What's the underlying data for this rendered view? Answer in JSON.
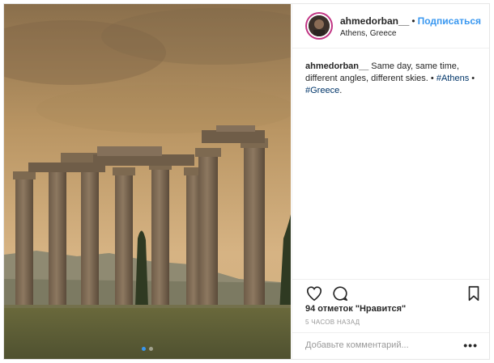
{
  "post": {
    "username": "ahmedorban__",
    "separator": "•",
    "follow_label": "Подписаться",
    "location": "Athens, Greece",
    "caption": {
      "username": "ahmedorban__",
      "text": " Same day, same time, different angles, different skies. • ",
      "tag1": "#Athens",
      "bullet": " • ",
      "tag2": "#Greece",
      "end": "."
    },
    "likes_text": "94 отметок \"Нравится\"",
    "time_text": "5 ЧАСОВ НАЗАД",
    "comment_placeholder": "Добавьте комментарий...",
    "more_label": "•••",
    "carousel": {
      "count": 2,
      "active_index": 0
    }
  },
  "icons": {
    "like": "heart-icon",
    "comment": "comment-bubble-icon",
    "save": "bookmark-icon",
    "more": "more-options-icon"
  },
  "colors": {
    "link": "#3897f0",
    "hashtag": "#003569",
    "avatar_ring": "#c13584",
    "sky": "#c8a470"
  }
}
